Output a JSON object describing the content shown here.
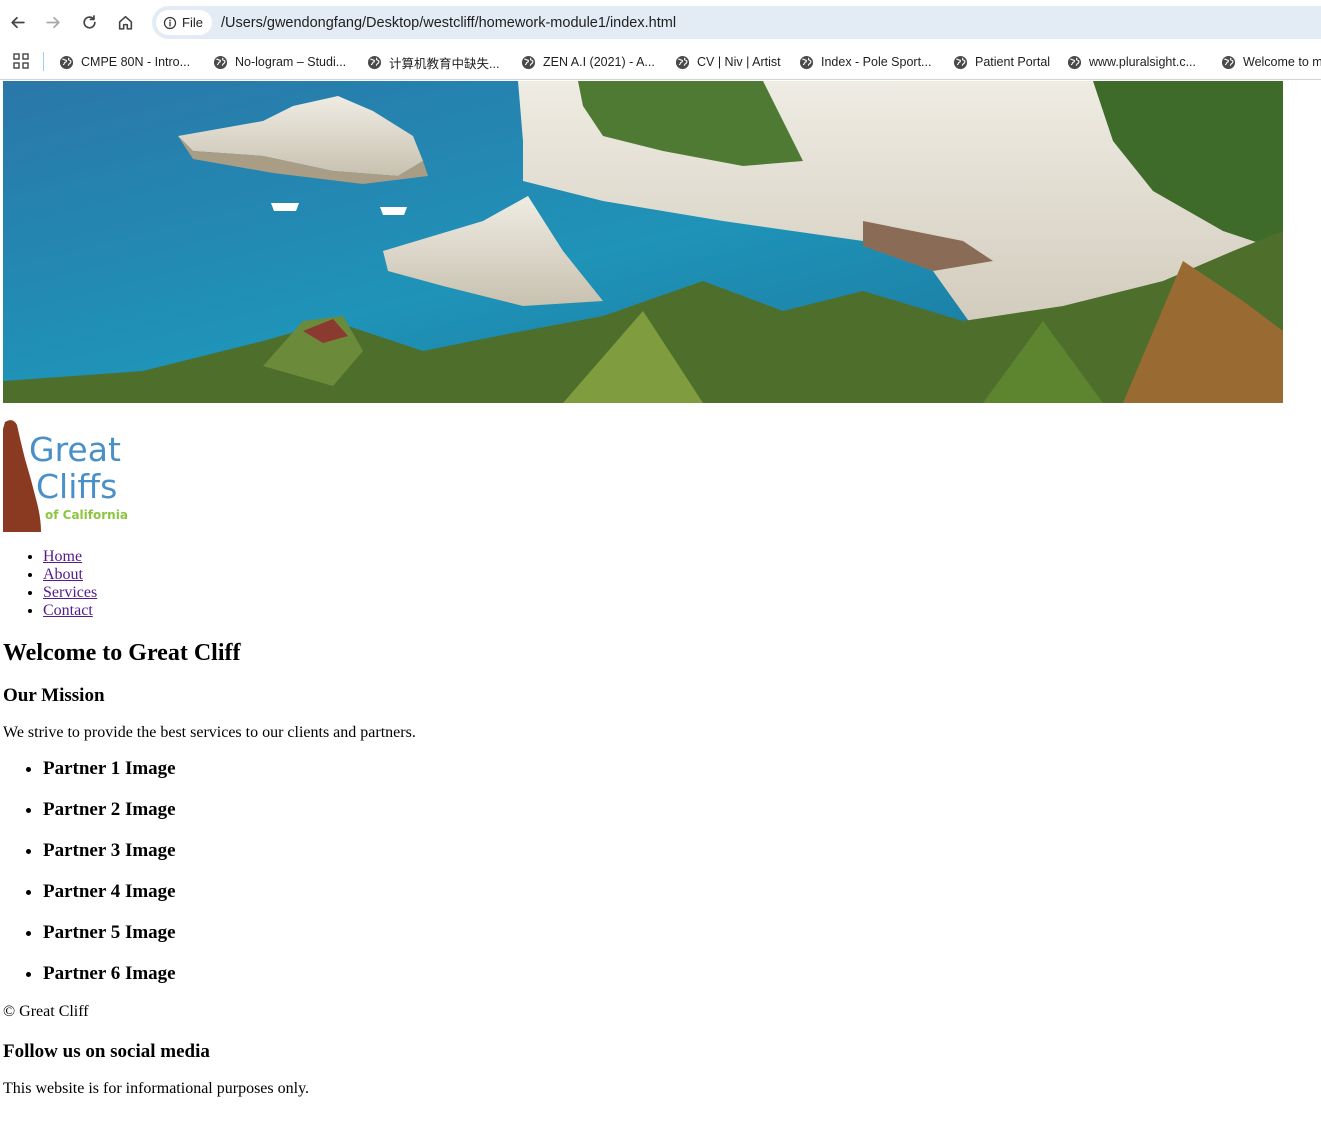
{
  "browser": {
    "chip_label": "File",
    "url": "/Users/gwendongfang/Desktop/westcliff/homework-module1/index.html",
    "bookmarks": [
      "CMPE 80N - Intro...",
      "No-logram – Studi...",
      "计算机教育中缺失...",
      "ZEN A.I (2021) - A...",
      "CV | Niv | Artist",
      "Index - Pole Sport...",
      "Patient Portal",
      "www.pluralsight.c...",
      "Welcome to m"
    ]
  },
  "logo": {
    "line1": "Great",
    "line2": "Cliffs",
    "line3": "of California",
    "colors": {
      "blue": "#4a90c8",
      "green": "#8cc63f",
      "rust": "#8b3a22"
    }
  },
  "nav": [
    "Home",
    "About",
    "Services",
    "Contact"
  ],
  "main": {
    "title": "Welcome to Great Cliff",
    "mission_heading": "Our Mission",
    "mission_text": "We strive to provide the best services to our clients and partners.",
    "partners": [
      "Partner 1 Image",
      "Partner 2 Image",
      "Partner 3 Image",
      "Partner 4 Image",
      "Partner 5 Image",
      "Partner 6 Image"
    ]
  },
  "footer": {
    "copyright": "© Great Cliff",
    "social_heading": "Follow us on social media",
    "disclaimer": "This website is for informational purposes only."
  }
}
